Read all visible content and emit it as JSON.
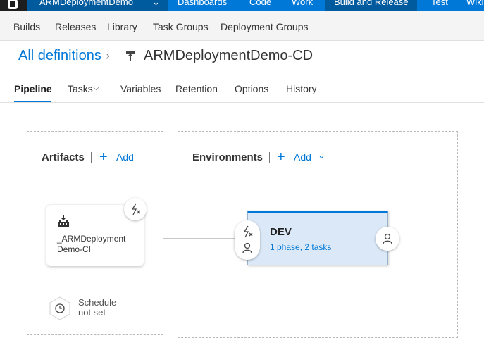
{
  "topbar": {
    "project": "ARMDeploymentDemo",
    "tabs": [
      "Dashboards",
      "Code",
      "Work",
      "Build and Release",
      "Test",
      "Wiki"
    ],
    "active_tab": "Build and Release"
  },
  "subnav": {
    "items": [
      "Builds",
      "Releases",
      "Library",
      "Task Groups",
      "Deployment Groups"
    ]
  },
  "breadcrumb": {
    "root": "All definitions",
    "separator": "›"
  },
  "definition": {
    "title": "ARMDeploymentDemo-CD",
    "icon": "release-definition-icon"
  },
  "tabs": {
    "items": [
      "Pipeline",
      "Tasks",
      "Variables",
      "Retention",
      "Options",
      "History"
    ],
    "active": "Pipeline",
    "dropdown_tab": "Tasks"
  },
  "artifacts": {
    "title": "Artifacts",
    "add_label": "Add",
    "artifact_name_line1": "_ARMDeployment",
    "artifact_name_line2": "Demo-CI",
    "schedule_line1": "Schedule",
    "schedule_line2": "not set"
  },
  "environments": {
    "title": "Environments",
    "add_label": "Add",
    "env_name": "DEV",
    "env_summary": "1 phase, 2 tasks"
  },
  "colors": {
    "accent": "#0078d7",
    "topbar": "#0078d7",
    "env_card_bg": "#dbe8f7"
  }
}
